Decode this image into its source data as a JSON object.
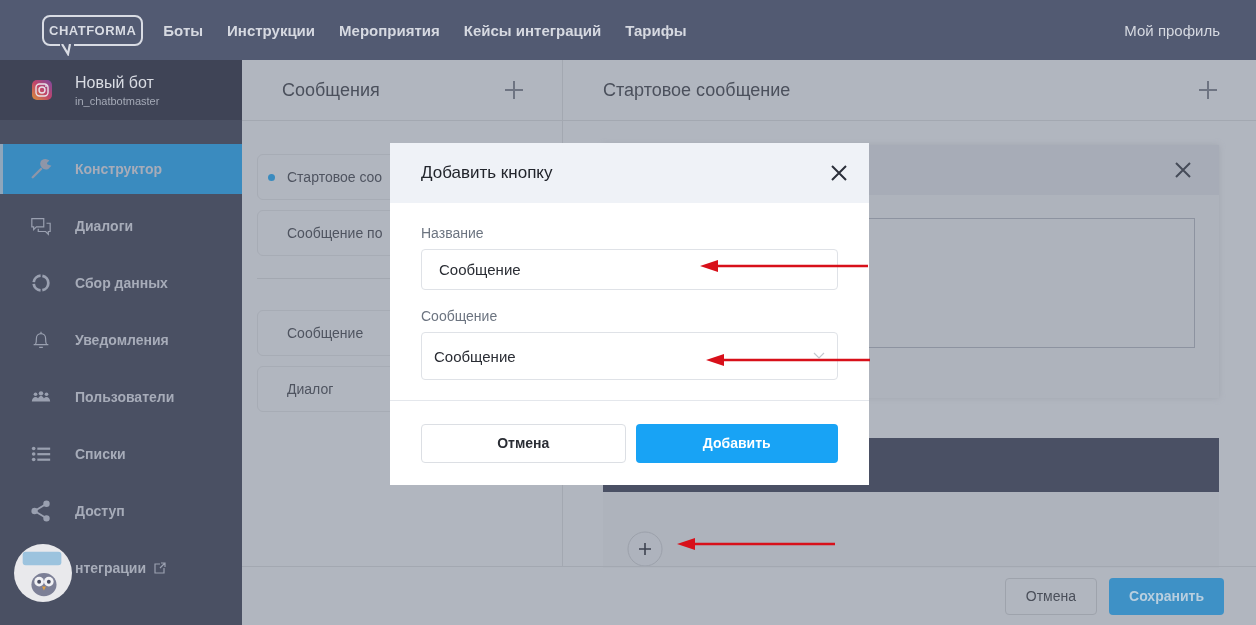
{
  "top_nav": {
    "logo": "CHATFORMA",
    "links": [
      "Боты",
      "Инструкции",
      "Мероприятия",
      "Кейсы интеграций",
      "Тарифы"
    ],
    "profile": "Мой профиль"
  },
  "bot": {
    "name": "Новый бот",
    "handle": "in_chatbotmaster"
  },
  "sidebar": {
    "items": [
      {
        "label": "Конструктор",
        "selected": true,
        "external": false
      },
      {
        "label": "Диалоги",
        "selected": false,
        "external": false
      },
      {
        "label": "Сбор данных",
        "selected": false,
        "external": false
      },
      {
        "label": "Уведомления",
        "selected": false,
        "external": false
      },
      {
        "label": "Пользователи",
        "selected": false,
        "external": false
      },
      {
        "label": "Списки",
        "selected": false,
        "external": false
      },
      {
        "label": "Доступ",
        "selected": false,
        "external": false
      },
      {
        "label": "нтеграции",
        "selected": false,
        "external": true
      }
    ]
  },
  "messages_panel": {
    "title": "Сообщения",
    "groups": [
      [
        {
          "label": "Стартовое соо",
          "selected": true
        },
        {
          "label": "Сообщение по",
          "selected": false
        }
      ],
      [
        {
          "label": "Сообщение",
          "selected": false
        },
        {
          "label": "Диалог",
          "selected": false
        }
      ]
    ]
  },
  "editor": {
    "title": "Стартовое сообщение"
  },
  "footer": {
    "buttons": [
      {
        "label": "Отмена",
        "kind": "secondary"
      },
      {
        "label": "Сохранить",
        "kind": "primary"
      }
    ]
  },
  "dialog": {
    "title": "Добавить кнопку",
    "fields": [
      {
        "label": "Название",
        "value": "Сообщение",
        "kind": "text"
      },
      {
        "label": "Сообщение",
        "value": "Сообщение",
        "kind": "select"
      }
    ],
    "buttons": [
      {
        "label": "Отмена",
        "kind": "secondary"
      },
      {
        "label": "Добавить",
        "kind": "primary"
      }
    ]
  }
}
